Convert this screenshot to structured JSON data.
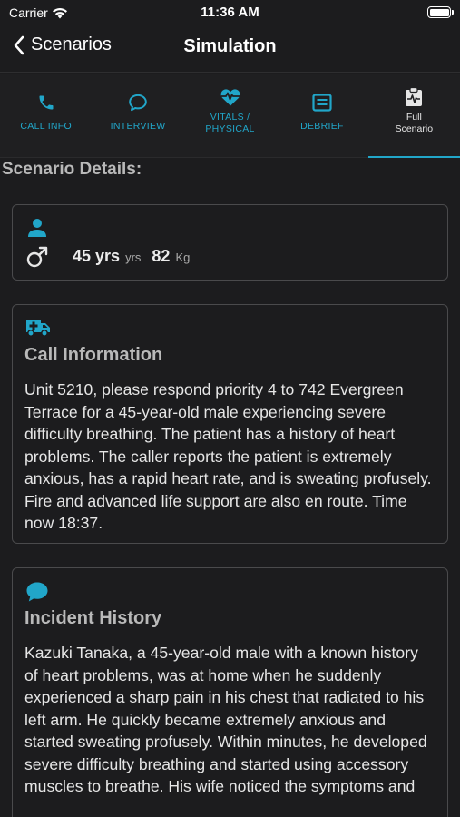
{
  "status_bar": {
    "carrier": "Carrier",
    "time": "11:36 AM"
  },
  "nav": {
    "back_label": "Scenarios",
    "title": "Simulation"
  },
  "tabs": [
    {
      "label": "CALL INFO",
      "icon": "phone-icon"
    },
    {
      "label": "INTERVIEW",
      "icon": "chat-bubble-icon"
    },
    {
      "label": "VITALS /\nPHYSICAL",
      "icon": "heartbeat-icon"
    },
    {
      "label": "DEBRIEF",
      "icon": "notes-icon"
    },
    {
      "label": "Full\nScenario",
      "icon": "clipboard-pulse-icon",
      "active": true
    }
  ],
  "section_heading": "Scenario Details:",
  "patient": {
    "age": "45 yrs",
    "age_unit": "yrs",
    "weight": "82",
    "weight_unit": "Kg"
  },
  "call_info": {
    "title": "Call Information",
    "body": "Unit 5210, please respond priority 4 to 742 Evergreen Terrace for a 45-year-old male experiencing severe difficulty breathing. The patient has a history of heart problems. The caller reports the patient is extremely anxious, has a rapid heart rate, and is sweating profusely. Fire and advanced life support are also en route. Time now 18:37."
  },
  "incident_history": {
    "title": "Incident History",
    "body": "Kazuki Tanaka, a 45-year-old male with a known history of heart problems, was at home when he suddenly experienced a sharp pain in his chest that radiated to his left arm. He quickly became extremely anxious and started sweating profusely. Within minutes, he developed severe difficulty breathing and started using accessory muscles to breathe. His wife noticed the symptoms and"
  },
  "colors": {
    "accent": "#21a6c9",
    "background": "#1c1c1e",
    "card_border": "#4a4a4c"
  }
}
